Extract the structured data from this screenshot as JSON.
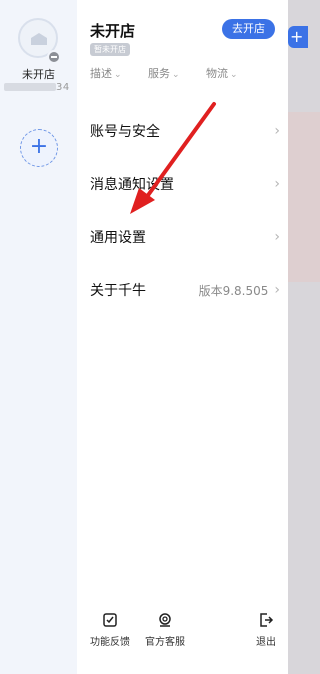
{
  "rail": {
    "shop_name": "未开店",
    "account_id_suffix": "34",
    "add_label": "+"
  },
  "panel": {
    "shop_title": "未开店",
    "shop_tag": "暂未开店",
    "open_button": "去开店",
    "metrics": [
      {
        "label": "描述",
        "chevron": "⌄"
      },
      {
        "label": "服务",
        "chevron": "⌄"
      },
      {
        "label": "物流",
        "chevron": "⌄"
      }
    ],
    "menu": [
      {
        "label": "账号与安全",
        "value": ""
      },
      {
        "label": "消息通知设置",
        "value": ""
      },
      {
        "label": "通用设置",
        "value": ""
      },
      {
        "label": "关于千牛",
        "value": "版本9.8.505"
      }
    ],
    "chevron": "›",
    "bottom": {
      "feedback": "功能反馈",
      "service": "官方客服",
      "logout": "退出"
    }
  },
  "colors": {
    "accent": "#3b72e6",
    "annotation_arrow": "#e02020"
  }
}
